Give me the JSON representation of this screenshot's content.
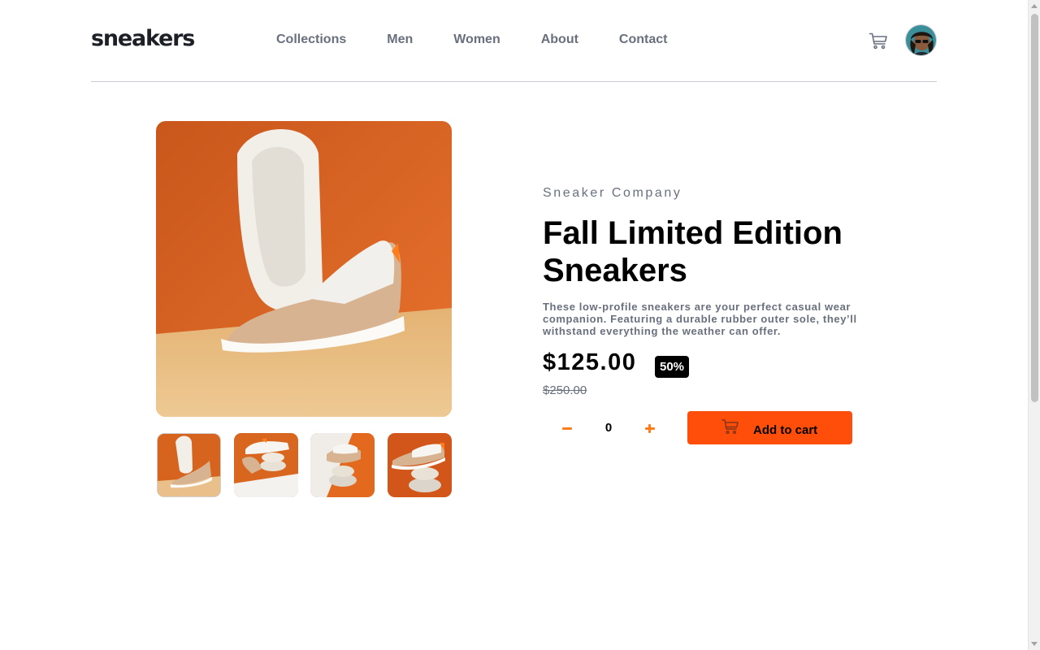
{
  "header": {
    "logo": "sneakers",
    "nav": [
      "Collections",
      "Men",
      "Women",
      "About",
      "Contact"
    ],
    "cart_icon": "cart-icon",
    "avatar_icon": "avatar"
  },
  "product": {
    "company": "Sneaker Company",
    "title": "Fall Limited Edition Sneakers",
    "description": "These low-profile sneakers are your perfect casual wear companion. Featuring a durable rubber outer sole, they’ll withstand everything the weather can offer.",
    "price": "$125.00",
    "discount": "50%",
    "old_price": "$250.00",
    "quantity": "0",
    "add_to_cart": "Add to cart"
  },
  "colors": {
    "accent": "#ff7e1b",
    "button": "#ff4d0a",
    "text_dark": "#1d2026",
    "text_gray": "#69707d"
  }
}
